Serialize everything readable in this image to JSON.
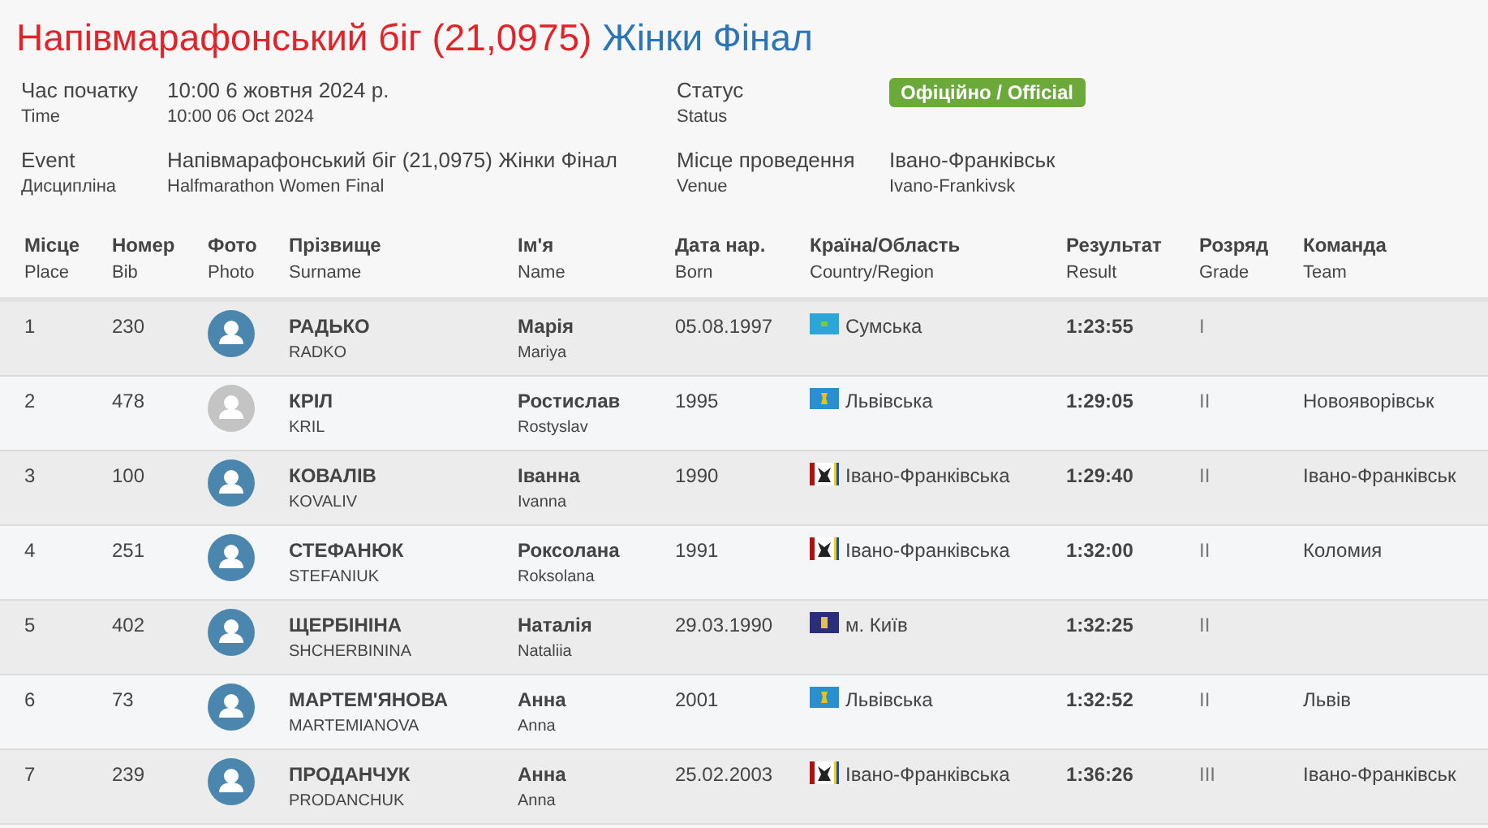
{
  "title": {
    "main": "Напівмарафонський біг (21,0975)",
    "sub": "Жінки Фінал"
  },
  "info": [
    {
      "label": "Час початку",
      "label_en": "Time",
      "value": "10:00 6 жовтня 2024 р.",
      "value_en": "10:00 06 Oct 2024"
    },
    {
      "label": "Статус",
      "label_en": "Status",
      "badge": "Офіційно / Official"
    },
    {
      "label": "Event",
      "label_en": "Дисципліна",
      "value": "Напівмарафонський біг (21,0975) Жінки Фінал",
      "value_en": "Halfmarathon Women Final"
    },
    {
      "label": "Місце проведення",
      "label_en": "Venue",
      "value": "Івано-Франківськ",
      "value_en": "Ivano-Frankivsk"
    }
  ],
  "table": {
    "columns": [
      {
        "label": "Місце",
        "label_en": "Place"
      },
      {
        "label": "Номер",
        "label_en": "Bib"
      },
      {
        "label": "Фото",
        "label_en": "Photo"
      },
      {
        "label": "Прізвище",
        "label_en": "Surname"
      },
      {
        "label": "Ім'я",
        "label_en": "Name"
      },
      {
        "label": "Дата нар.",
        "label_en": "Born"
      },
      {
        "label": "Країна/Область",
        "label_en": "Country/Region"
      },
      {
        "label": "Результат",
        "label_en": "Result"
      },
      {
        "label": "Розряд",
        "label_en": "Grade"
      },
      {
        "label": "Команда",
        "label_en": "Team"
      }
    ],
    "rows": [
      {
        "place": "1",
        "bib": "230",
        "photo_set": true,
        "surname": "РАДЬКО",
        "surname_en": "RADKO",
        "name": "Марія",
        "name_en": "Mariya",
        "born": "05.08.1997",
        "region": {
          "kind": "sumy",
          "label": "Сумська"
        },
        "result": "1:23:55",
        "grade": "I"
      },
      {
        "place": "2",
        "bib": "478",
        "photo_set": false,
        "surname": "КРІЛ",
        "surname_en": "KRIL",
        "name": "Ростислав",
        "name_en": "Rostyslav",
        "born": "1995",
        "region": {
          "kind": "lviv",
          "label": "Львівська"
        },
        "result": "1:29:05",
        "grade": "II",
        "team": "Новояворівськ"
      },
      {
        "place": "3",
        "bib": "100",
        "photo_set": true,
        "surname": "КОВАЛІВ",
        "surname_en": "KOVALIV",
        "name": "Іванна",
        "name_en": "Ivanna",
        "born": "1990",
        "region": {
          "kind": "ivano-frankivsk",
          "label": "Івано-Франківська"
        },
        "result": "1:29:40",
        "grade": "II",
        "team": "Івано-Франківськ"
      },
      {
        "place": "4",
        "bib": "251",
        "photo_set": true,
        "surname": "СТЕФАНЮК",
        "surname_en": "STEFANIUK",
        "name": "Роксолана",
        "name_en": "Roksolana",
        "born": "1991",
        "region": {
          "kind": "ivano-frankivsk",
          "label": "Івано-Франківська"
        },
        "result": "1:32:00",
        "grade": "II",
        "team": "Коломия"
      },
      {
        "place": "5",
        "bib": "402",
        "photo_set": true,
        "surname": "ЩЕРБІНІНА",
        "surname_en": "SHCHERBININA",
        "name": "Наталія",
        "name_en": "Nataliia",
        "born": "29.03.1990",
        "region": {
          "kind": "kyiv",
          "label": "м. Київ"
        },
        "result": "1:32:25",
        "grade": "II"
      },
      {
        "place": "6",
        "bib": "73",
        "photo_set": true,
        "surname": "МАРТЕМ'ЯНОВА",
        "surname_en": "MARTEMIANOVA",
        "name": "Анна",
        "name_en": "Anna",
        "born": "2001",
        "region": {
          "kind": "lviv",
          "label": "Львівська"
        },
        "result": "1:32:52",
        "grade": "II",
        "team": "Львів"
      },
      {
        "place": "7",
        "bib": "239",
        "photo_set": true,
        "surname": "ПРОДАНЧУК",
        "surname_en": "PRODANCHUK",
        "name": "Анна",
        "name_en": "Anna",
        "born": "25.02.2003",
        "region": {
          "kind": "ivano-frankivsk",
          "label": "Івано-Франківська"
        },
        "result": "1:36:26",
        "grade": "III",
        "team": "Івано-Франківськ"
      }
    ]
  }
}
